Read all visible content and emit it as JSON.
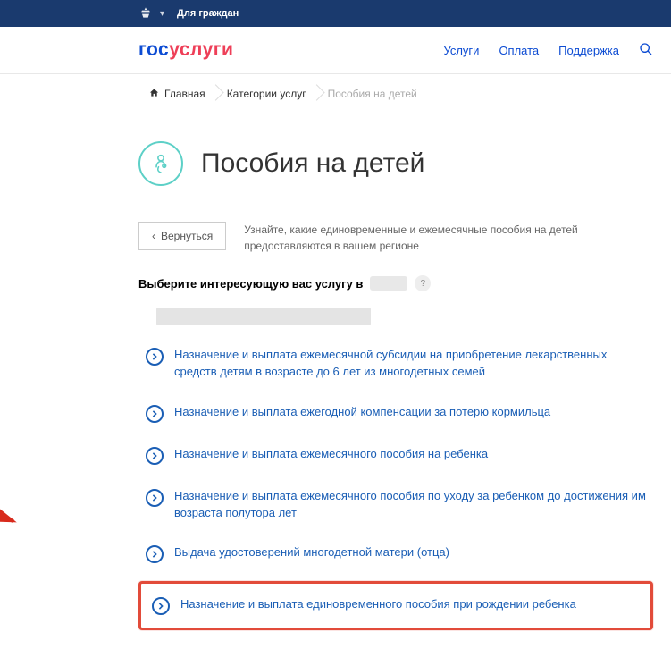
{
  "topbar": {
    "audience": "Для граждан"
  },
  "header": {
    "logo_part1": "гос",
    "logo_part2": "услуги",
    "nav": {
      "services": "Услуги",
      "payment": "Оплата",
      "support": "Поддержка"
    }
  },
  "breadcrumb": {
    "home": "Главная",
    "categories": "Категории услуг",
    "current": "Пособия на детей"
  },
  "page": {
    "title": "Пособия на детей",
    "back": "Вернуться",
    "intro": "Узнайте, какие единовременные и ежемесячные пособия на детей предоставляются в вашем регионе",
    "select_prompt": "Выберите интересующую вас услугу в ",
    "help": "?"
  },
  "services": [
    {
      "label": "Назначение и выплата ежемесячной субсидии на приобретение лекарственных средств детям в возрасте до 6 лет из многодетных семей"
    },
    {
      "label": "Назначение и выплата ежегодной компенсации за потерю кормильца"
    },
    {
      "label": "Назначение и выплата ежемесячного пособия на ребенка"
    },
    {
      "label": "Назначение и выплата ежемесячного пособия по уходу за ребенком до достижения им возраста полутора лет"
    },
    {
      "label": "Выдача удостоверений многодетной матери (отца)"
    },
    {
      "label": "Назначение и выплата единовременного пособия при рождении ребенка"
    }
  ]
}
